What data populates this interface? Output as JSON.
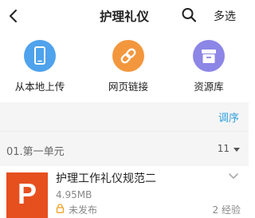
{
  "nav": {
    "title": "护理礼仪",
    "multi_select_label": "多选",
    "icons": {
      "back": "chevron-left-icon",
      "search": "search-icon"
    }
  },
  "sources": [
    {
      "label": "从本地上传",
      "icon": "phone-icon",
      "color": "#4fa2ec"
    },
    {
      "label": "网页链接",
      "icon": "link-icon",
      "color": "#f3973e"
    },
    {
      "label": "资源库",
      "icon": "archive-box-icon",
      "color": "#8c86e6"
    }
  ],
  "toolbar": {
    "sort_label": "调序",
    "accent_color": "#2f9fe0"
  },
  "section": {
    "name": "01.第一单元",
    "count": "11"
  },
  "item": {
    "title": "护理工作礼仪规范二",
    "size": "4.95MB",
    "status": "未发布",
    "experience": "2 经验",
    "thumb_letter": "P",
    "thumb_color": "#e6501f"
  }
}
